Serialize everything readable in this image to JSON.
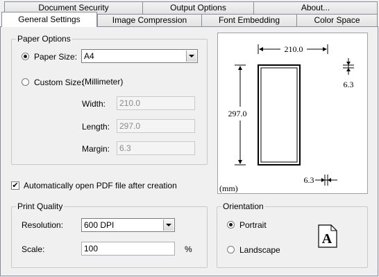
{
  "tabs": {
    "row1": [
      "Document Security",
      "Output Options",
      "About..."
    ],
    "row2": [
      "General Settings",
      "Image Compression",
      "Font Embedding",
      "Color Space"
    ]
  },
  "paper_options": {
    "legend": "Paper Options",
    "paper_size_label": "Paper Size:",
    "paper_size_value": "A4",
    "custom_size_label": "Custom Size:",
    "custom_size_unit": "(Millimeter)",
    "width_label": "Width:",
    "width_value": "210.0",
    "length_label": "Length:",
    "length_value": "297.0",
    "margin_label": "Margin:",
    "margin_value": "6.3"
  },
  "preview": {
    "width_dim": "210.0",
    "length_dim": "297.0",
    "margin_dim_top": "6.3",
    "margin_dim_bottom": "6.3",
    "unit": "(mm)"
  },
  "auto_open_label": "Automatically open PDF file after creation",
  "print_quality": {
    "legend": "Print Quality",
    "resolution_label": "Resolution:",
    "resolution_value": "600 DPI",
    "scale_label": "Scale:",
    "scale_value": "100",
    "scale_unit": "%"
  },
  "orientation": {
    "legend": "Orientation",
    "portrait_label": "Portrait",
    "landscape_label": "Landscape",
    "page_icon_letter": "A"
  }
}
